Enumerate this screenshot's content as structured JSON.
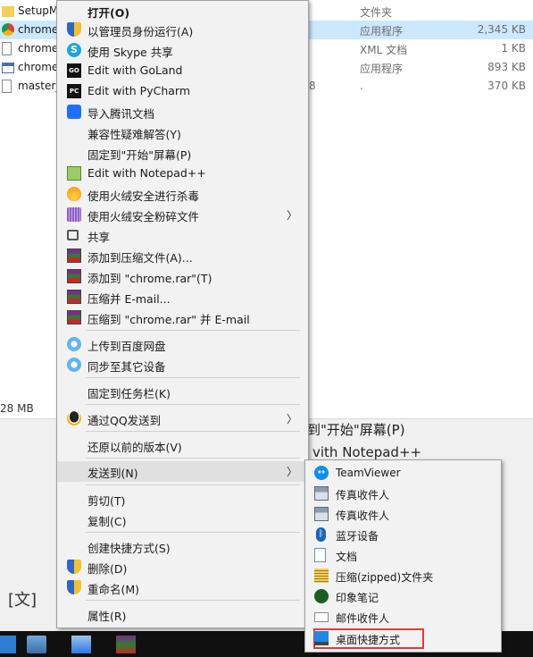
{
  "explorer": {
    "files": [
      {
        "name": "SetupM",
        "type": "文件夹",
        "size": "",
        "extra": ""
      },
      {
        "name": "chrome",
        "type": "应用程序",
        "size": "2,345 KB",
        "extra": ""
      },
      {
        "name": "chrome",
        "type": "XML 文档",
        "size": "1 KB",
        "extra": ""
      },
      {
        "name": "chrome",
        "type": "应用程序",
        "size": "893 KB",
        "extra": ""
      },
      {
        "name": "master_",
        "type": ".",
        "size": "370 KB",
        "extra": "8"
      }
    ],
    "status_text": "28 MB"
  },
  "background_texts": {
    "pin_start": "到\"开始\"屏幕(P)",
    "notepad": "vith Notepad++"
  },
  "context_menu": {
    "items": [
      {
        "label": "打开(O)",
        "icon": "none"
      },
      {
        "label": "以管理员身份运行(A)",
        "icon": "uac-shield-icon"
      },
      {
        "label": "使用 Skype 共享",
        "icon": "skype-icon"
      },
      {
        "label": "Edit with GoLand",
        "icon": "goland-icon"
      },
      {
        "label": "Edit with PyCharm",
        "icon": "pycharm-icon"
      },
      {
        "label": "导入腾讯文档",
        "icon": "tencent-docs-icon"
      },
      {
        "label": "兼容性疑难解答(Y)",
        "icon": "none"
      },
      {
        "label": "固定到\"开始\"屏幕(P)",
        "icon": "none"
      },
      {
        "label": "Edit with Notepad++",
        "icon": "notepadpp-icon"
      },
      {
        "label": "使用火绒安全进行杀毒",
        "icon": "huorong-icon"
      },
      {
        "label": "使用火绒安全粉碎文件",
        "icon": "shredder-icon"
      },
      {
        "label": "共享",
        "icon": "share-icon"
      },
      {
        "label": "添加到压缩文件(A)...",
        "icon": "winrar-icon"
      },
      {
        "label": "添加到 \"chrome.rar\"(T)",
        "icon": "winrar-icon"
      },
      {
        "label": "压缩并 E-mail...",
        "icon": "winrar-icon"
      },
      {
        "label": "压缩到 \"chrome.rar\" 并 E-mail",
        "icon": "winrar-icon"
      },
      {
        "label": "上传到百度网盘",
        "icon": "baidu-cloud-icon"
      },
      {
        "label": "同步至其它设备",
        "icon": "baidu-cloud-icon"
      },
      {
        "label": "固定到任务栏(K)",
        "icon": "none"
      },
      {
        "label": "通过QQ发送到",
        "icon": "qq-icon"
      },
      {
        "label": "还原以前的版本(V)",
        "icon": "none"
      },
      {
        "label": "发送到(N)",
        "icon": "none"
      },
      {
        "label": "剪切(T)",
        "icon": "none"
      },
      {
        "label": "复制(C)",
        "icon": "none"
      },
      {
        "label": "创建快捷方式(S)",
        "icon": "none"
      },
      {
        "label": "删除(D)",
        "icon": "uac-shield-icon"
      },
      {
        "label": "重命名(M)",
        "icon": "uac-shield-icon"
      },
      {
        "label": "属性(R)",
        "icon": "none"
      }
    ]
  },
  "send_to_menu": {
    "items": [
      {
        "label": "TeamViewer",
        "icon": "teamviewer-icon"
      },
      {
        "label": "传真收件人",
        "icon": "fax-icon"
      },
      {
        "label": "传真收件人",
        "icon": "fax-icon"
      },
      {
        "label": "蓝牙设备",
        "icon": "bluetooth-icon"
      },
      {
        "label": "文档",
        "icon": "documents-icon"
      },
      {
        "label": "压缩(zipped)文件夹",
        "icon": "zip-folder-icon"
      },
      {
        "label": "印象笔记",
        "icon": "evernote-icon"
      },
      {
        "label": "邮件收件人",
        "icon": "mail-icon"
      },
      {
        "label": "桌面快捷方式",
        "icon": "desktop-icon"
      }
    ]
  },
  "translate_glyph": "文",
  "colors": {
    "menu_bg": "#f2f2f2",
    "selection": "#cce8ff",
    "highlight_box": "#e53935",
    "taskbar": "#101010"
  }
}
